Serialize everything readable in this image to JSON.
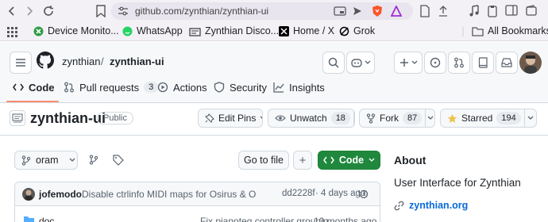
{
  "browser": {
    "url": "github.com/zynthian/zynthian-ui",
    "bookmarks": [
      {
        "label": "Device Monito..."
      },
      {
        "label": "WhatsApp"
      },
      {
        "label": "Zynthian Disco..."
      },
      {
        "label": "Home / X"
      },
      {
        "label": "Grok"
      }
    ],
    "all_bookmarks": "All Bookmarks"
  },
  "header": {
    "owner": "zynthian",
    "separator": "/",
    "repo": "zynthian-ui",
    "tabs": [
      {
        "label": "Code",
        "active": true
      },
      {
        "label": "Pull requests",
        "count": "3"
      },
      {
        "label": "Actions"
      },
      {
        "label": "Security"
      },
      {
        "label": "Insights"
      }
    ]
  },
  "repo": {
    "name": "zynthian-ui",
    "visibility": "Public",
    "edit_pins": "Edit Pins",
    "unwatch": "Unwatch",
    "watch_count": "18",
    "fork": "Fork",
    "fork_count": "87",
    "starred": "Starred",
    "star_count": "194"
  },
  "toolbar": {
    "branch": "oram",
    "go_to_file": "Go to file",
    "add": "+",
    "code": "Code"
  },
  "commit": {
    "author": "jofemodo",
    "message": "Disable ctrlinfo MIDI maps for Osirus & OsT...",
    "hash": "dd2228f",
    "time": "· 4 days ago"
  },
  "files": [
    {
      "name": "doc",
      "message": "Fix pianoteq controller groupin...",
      "time": "10 months ago"
    }
  ],
  "about": {
    "title": "About",
    "description": "User Interface for Zynthian",
    "link": "zynthian.org"
  },
  "colors": {
    "accent_green": "#1f883d",
    "link_blue": "#0969da",
    "tab_underline": "#fd8c73",
    "star": "#eac54f"
  }
}
